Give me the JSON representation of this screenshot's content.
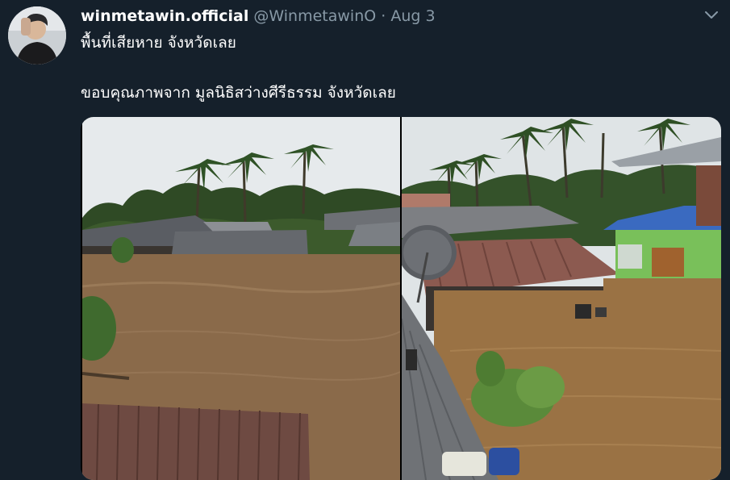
{
  "tweet": {
    "display_name": "winmetawin.official",
    "handle": "@WinmetawinO",
    "separator": "·",
    "date": "Aug 3",
    "text_line1": "พื้นที่เสียหาย จังหวัดเลย",
    "text_line2": "ขอบคุณภาพจาก มูลนิธิสว่างศีรีธรรม จังหวัดเลย"
  },
  "icons": {
    "menu": "chevron-down-icon"
  },
  "colors": {
    "background": "#15202b",
    "secondary_text": "#8899a6",
    "primary_text": "#ffffff",
    "flood_water": "#8a6a4a"
  }
}
